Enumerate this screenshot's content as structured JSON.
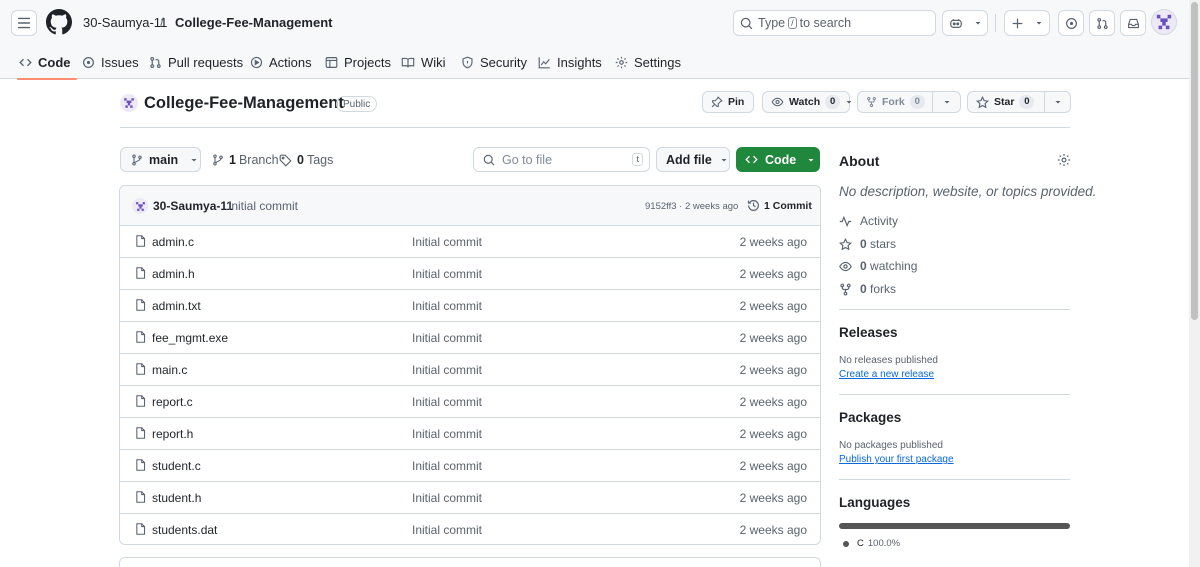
{
  "header": {
    "owner": "30-Saumya-11",
    "separator": "/",
    "repo": "College-Fee-Management",
    "search": {
      "prefix": "Type",
      "key": "/",
      "suffix": "to search"
    }
  },
  "tabs": [
    {
      "label": "Code",
      "icon": "code-icon",
      "active": true
    },
    {
      "label": "Issues",
      "icon": "issue-opened-icon"
    },
    {
      "label": "Pull requests",
      "icon": "git-pull-request-icon"
    },
    {
      "label": "Actions",
      "icon": "play-icon"
    },
    {
      "label": "Projects",
      "icon": "table-icon"
    },
    {
      "label": "Wiki",
      "icon": "book-icon"
    },
    {
      "label": "Security",
      "icon": "shield-icon"
    },
    {
      "label": "Insights",
      "icon": "graph-icon"
    },
    {
      "label": "Settings",
      "icon": "gear-icon"
    }
  ],
  "repo": {
    "name": "College-Fee-Management",
    "visibility": "Public",
    "pin_label": "Pin",
    "watch_label": "Watch",
    "watch_count": "0",
    "fork_label": "Fork",
    "fork_count": "0",
    "star_label": "Star",
    "star_count": "0"
  },
  "toolbar": {
    "branch": "main",
    "branches_count": "1",
    "branches_label": "Branch",
    "tags_count": "0",
    "tags_label": "Tags",
    "goto_placeholder": "Go to file",
    "goto_key": "t",
    "add_file": "Add file",
    "code": "Code"
  },
  "latest_commit": {
    "author": "30-Saumya-11",
    "message": "Initial commit",
    "hash_age": "9152ff3 · 2 weeks ago",
    "commits_count_label": "1 Commit"
  },
  "files": [
    {
      "name": "admin.c",
      "commit": "Initial commit",
      "age": "2 weeks ago"
    },
    {
      "name": "admin.h",
      "commit": "Initial commit",
      "age": "2 weeks ago"
    },
    {
      "name": "admin.txt",
      "commit": "Initial commit",
      "age": "2 weeks ago"
    },
    {
      "name": "fee_mgmt.exe",
      "commit": "Initial commit",
      "age": "2 weeks ago"
    },
    {
      "name": "main.c",
      "commit": "Initial commit",
      "age": "2 weeks ago"
    },
    {
      "name": "report.c",
      "commit": "Initial commit",
      "age": "2 weeks ago"
    },
    {
      "name": "report.h",
      "commit": "Initial commit",
      "age": "2 weeks ago"
    },
    {
      "name": "student.c",
      "commit": "Initial commit",
      "age": "2 weeks ago"
    },
    {
      "name": "student.h",
      "commit": "Initial commit",
      "age": "2 weeks ago"
    },
    {
      "name": "students.dat",
      "commit": "Initial commit",
      "age": "2 weeks ago"
    }
  ],
  "about": {
    "title": "About",
    "description": "No description, website, or topics provided.",
    "activity": "Activity",
    "stars_count": "0",
    "stars_label": "stars",
    "watching_count": "0",
    "watching_label": "watching",
    "forks_count": "0",
    "forks_label": "forks"
  },
  "releases": {
    "title": "Releases",
    "empty": "No releases published",
    "link": "Create a new release"
  },
  "packages": {
    "title": "Packages",
    "empty": "No packages published",
    "link": "Publish your first package"
  },
  "languages": {
    "title": "Languages",
    "items": [
      {
        "name": "C",
        "percent": "100.0%",
        "fraction": 1.0,
        "color": "#555555"
      }
    ]
  },
  "colors": {
    "accent_green": "#1f883d",
    "link_blue": "#0969da",
    "active_tab_underline": "#fd8c73"
  }
}
